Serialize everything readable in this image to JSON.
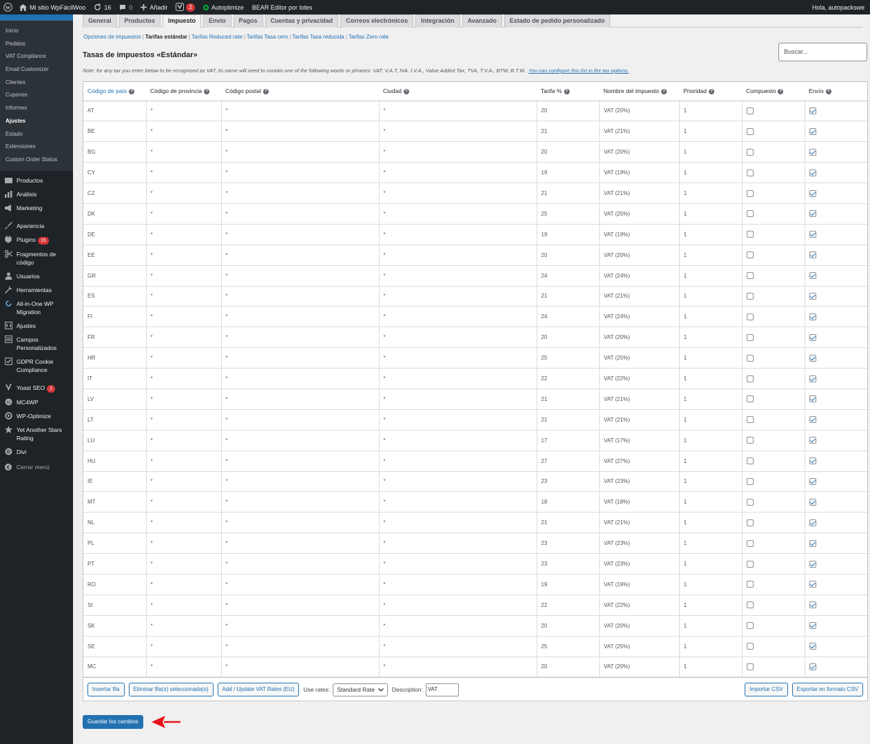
{
  "adminbar": {
    "site_name": "Mi sitio WpFácilWoo",
    "updates_count": "16",
    "comments_count": "0",
    "add_new": "Añadir",
    "yoast_badge": "2",
    "autoptimize": "Autoptimize",
    "bear": "BEAR Editor por lotes",
    "greeting": "Hola, autopackswe"
  },
  "sidebar": {
    "woo_submenu": [
      {
        "label": "Inicio",
        "current": false
      },
      {
        "label": "Pedidos",
        "current": false
      },
      {
        "label": "VAT Compliance",
        "current": false
      },
      {
        "label": "Email Customizer",
        "current": false
      },
      {
        "label": "Clientes",
        "current": false
      },
      {
        "label": "Cupones",
        "current": false
      },
      {
        "label": "Informes",
        "current": false
      },
      {
        "label": "Ajustes",
        "current": true
      },
      {
        "label": "Estado",
        "current": false
      },
      {
        "label": "Extensiones",
        "current": false
      },
      {
        "label": "Custom Order Status",
        "current": false
      }
    ],
    "menu": [
      {
        "label": "Productos",
        "icon": "products-icon"
      },
      {
        "label": "Análisis",
        "icon": "analytics-icon"
      },
      {
        "label": "Marketing",
        "icon": "megaphone-icon"
      },
      {
        "label": "Apariencia",
        "icon": "brush-icon"
      },
      {
        "label": "Plugins",
        "icon": "plugin-icon",
        "badge": "15"
      },
      {
        "label": "Fragmentos de código",
        "icon": "scissors-icon"
      },
      {
        "label": "Usuarios",
        "icon": "user-icon"
      },
      {
        "label": "Herramientas",
        "icon": "wrench-icon"
      },
      {
        "label": "All-in-One WP Migration",
        "icon": "migration-icon"
      },
      {
        "label": "Ajustes",
        "icon": "settings-icon"
      },
      {
        "label": "Campos Personalizados",
        "icon": "fields-icon"
      },
      {
        "label": "GDPR Cookie Compliance",
        "icon": "shield-check-icon"
      },
      {
        "label": "Yoast SEO",
        "icon": "yoast-icon",
        "badge": "2"
      },
      {
        "label": "MC4WP",
        "icon": "mc4wp-icon"
      },
      {
        "label": "WP-Optimize",
        "icon": "optimize-icon"
      },
      {
        "label": "Yet Another Stars Rating",
        "icon": "star-icon"
      },
      {
        "label": "Divi",
        "icon": "divi-icon"
      }
    ],
    "collapse_label": "Cerrar menú"
  },
  "tabs": [
    "General",
    "Productos",
    "Impuesto",
    "Envío",
    "Pagos",
    "Cuentas y privacidad",
    "Correos electrónicos",
    "Integración",
    "Avanzado",
    "Estado de pedido personalizado"
  ],
  "active_tab": "Impuesto",
  "sections": [
    "Opciones de impuestos",
    "Tarifas estándar",
    "Tarifas Reduced rate",
    "Tarifas Tasa cero",
    "Tarifas Tasa reducida",
    "Tarifas Zero rate"
  ],
  "current_section": "Tarifas estándar",
  "page_title": "Tasas de impuestos «Estándar»",
  "search_placeholder": "Buscar...",
  "note": {
    "text": "Note: for any tax you enter below to be recognised as VAT, its name will need to contain one of the following words or phrases: VAT, V.A.T, IVA, I.V.A., Value Added Tax, TVA, T.V.A., BTW, B.T.W..",
    "link": "You can configure this list in the tax options."
  },
  "columns": [
    "Código de país",
    "Código de provincia",
    "Código postal",
    "Ciudad",
    "Tarifa %",
    "Nombre del impuesto",
    "Prioridad",
    "Compuesto",
    "Envío"
  ],
  "rows": [
    {
      "country": "AT",
      "state": "*",
      "postcode": "*",
      "city": "*",
      "rate": "20",
      "name": "VAT (20%)",
      "priority": "1",
      "compound": false,
      "shipping": true
    },
    {
      "country": "BE",
      "state": "*",
      "postcode": "*",
      "city": "*",
      "rate": "21",
      "name": "VAT (21%)",
      "priority": "1",
      "compound": false,
      "shipping": true
    },
    {
      "country": "BG",
      "state": "*",
      "postcode": "*",
      "city": "*",
      "rate": "20",
      "name": "VAT (20%)",
      "priority": "1",
      "compound": false,
      "shipping": true
    },
    {
      "country": "CY",
      "state": "*",
      "postcode": "*",
      "city": "*",
      "rate": "19",
      "name": "VAT (19%)",
      "priority": "1",
      "compound": false,
      "shipping": true
    },
    {
      "country": "CZ",
      "state": "*",
      "postcode": "*",
      "city": "*",
      "rate": "21",
      "name": "VAT (21%)",
      "priority": "1",
      "compound": false,
      "shipping": true
    },
    {
      "country": "DK",
      "state": "*",
      "postcode": "*",
      "city": "*",
      "rate": "25",
      "name": "VAT (25%)",
      "priority": "1",
      "compound": false,
      "shipping": true
    },
    {
      "country": "DE",
      "state": "*",
      "postcode": "*",
      "city": "*",
      "rate": "19",
      "name": "VAT (19%)",
      "priority": "1",
      "compound": false,
      "shipping": true
    },
    {
      "country": "EE",
      "state": "*",
      "postcode": "*",
      "city": "*",
      "rate": "20",
      "name": "VAT (20%)",
      "priority": "1",
      "compound": false,
      "shipping": true
    },
    {
      "country": "GR",
      "state": "*",
      "postcode": "*",
      "city": "*",
      "rate": "24",
      "name": "VAT (24%)",
      "priority": "1",
      "compound": false,
      "shipping": true
    },
    {
      "country": "ES",
      "state": "*",
      "postcode": "*",
      "city": "*",
      "rate": "21",
      "name": "VAT (21%)",
      "priority": "1",
      "compound": false,
      "shipping": true
    },
    {
      "country": "FI",
      "state": "*",
      "postcode": "*",
      "city": "*",
      "rate": "24",
      "name": "VAT (24%)",
      "priority": "1",
      "compound": false,
      "shipping": true
    },
    {
      "country": "FR",
      "state": "*",
      "postcode": "*",
      "city": "*",
      "rate": "20",
      "name": "VAT (20%)",
      "priority": "1",
      "compound": false,
      "shipping": true
    },
    {
      "country": "HR",
      "state": "*",
      "postcode": "*",
      "city": "*",
      "rate": "25",
      "name": "VAT (25%)",
      "priority": "1",
      "compound": false,
      "shipping": true
    },
    {
      "country": "IT",
      "state": "*",
      "postcode": "*",
      "city": "*",
      "rate": "22",
      "name": "VAT (22%)",
      "priority": "1",
      "compound": false,
      "shipping": true
    },
    {
      "country": "LV",
      "state": "*",
      "postcode": "*",
      "city": "*",
      "rate": "21",
      "name": "VAT (21%)",
      "priority": "1",
      "compound": false,
      "shipping": true
    },
    {
      "country": "LT",
      "state": "*",
      "postcode": "*",
      "city": "*",
      "rate": "21",
      "name": "VAT (21%)",
      "priority": "1",
      "compound": false,
      "shipping": true
    },
    {
      "country": "LU",
      "state": "*",
      "postcode": "*",
      "city": "*",
      "rate": "17",
      "name": "VAT (17%)",
      "priority": "1",
      "compound": false,
      "shipping": true
    },
    {
      "country": "HU",
      "state": "*",
      "postcode": "*",
      "city": "*",
      "rate": "27",
      "name": "VAT (27%)",
      "priority": "1",
      "compound": false,
      "shipping": true
    },
    {
      "country": "IE",
      "state": "*",
      "postcode": "*",
      "city": "*",
      "rate": "23",
      "name": "VAT (23%)",
      "priority": "1",
      "compound": false,
      "shipping": true
    },
    {
      "country": "MT",
      "state": "*",
      "postcode": "*",
      "city": "*",
      "rate": "18",
      "name": "VAT (18%)",
      "priority": "1",
      "compound": false,
      "shipping": true
    },
    {
      "country": "NL",
      "state": "*",
      "postcode": "*",
      "city": "*",
      "rate": "21",
      "name": "VAT (21%)",
      "priority": "1",
      "compound": false,
      "shipping": true
    },
    {
      "country": "PL",
      "state": "*",
      "postcode": "*",
      "city": "*",
      "rate": "23",
      "name": "VAT (23%)",
      "priority": "1",
      "compound": false,
      "shipping": true
    },
    {
      "country": "PT",
      "state": "*",
      "postcode": "*",
      "city": "*",
      "rate": "23",
      "name": "VAT (23%)",
      "priority": "1",
      "compound": false,
      "shipping": true
    },
    {
      "country": "RO",
      "state": "*",
      "postcode": "*",
      "city": "*",
      "rate": "19",
      "name": "VAT (19%)",
      "priority": "1",
      "compound": false,
      "shipping": true
    },
    {
      "country": "SI",
      "state": "*",
      "postcode": "*",
      "city": "*",
      "rate": "22",
      "name": "VAT (22%)",
      "priority": "1",
      "compound": false,
      "shipping": true
    },
    {
      "country": "SK",
      "state": "*",
      "postcode": "*",
      "city": "*",
      "rate": "20",
      "name": "VAT (20%)",
      "priority": "1",
      "compound": false,
      "shipping": true
    },
    {
      "country": "SE",
      "state": "*",
      "postcode": "*",
      "city": "*",
      "rate": "25",
      "name": "VAT (25%)",
      "priority": "1",
      "compound": false,
      "shipping": true
    },
    {
      "country": "MC",
      "state": "*",
      "postcode": "*",
      "city": "*",
      "rate": "20",
      "name": "VAT (20%)",
      "priority": "1",
      "compound": false,
      "shipping": true
    }
  ],
  "footer": {
    "insert_row": "Insertar fila",
    "remove_rows": "Eliminar fila(s) seleccionada(s)",
    "add_vat": "Add / Update VAT Rates (EU)",
    "use_rates_label": "Use rates:",
    "use_rates_value": "Standard Rate",
    "description_label": "Description:",
    "description_value": "VAT",
    "import_csv": "Importar CSV",
    "export_csv": "Exportar en formato CSV"
  },
  "save_button": "Guardar los cambios",
  "colors": {
    "accent": "#2271b1",
    "admin_dark": "#1d2327",
    "annotation_arrow": "#e8141e"
  }
}
